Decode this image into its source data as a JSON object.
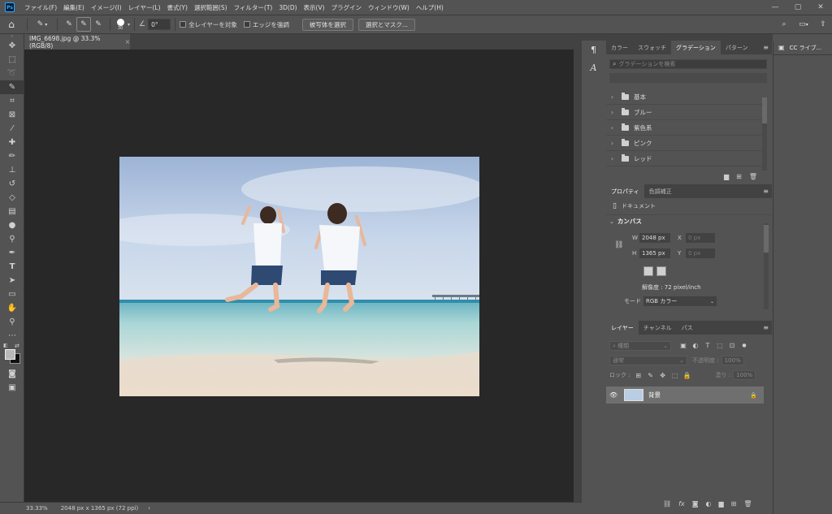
{
  "app": {
    "logo": "Ps"
  },
  "menu": [
    "ファイル(F)",
    "編集(E)",
    "イメージ(I)",
    "レイヤー(L)",
    "書式(Y)",
    "選択範囲(S)",
    "フィルター(T)",
    "3D(D)",
    "表示(V)",
    "プラグイン",
    "ウィンドウ(W)",
    "ヘルプ(H)"
  ],
  "window_controls": {
    "minimize": "—",
    "maximize": "▢",
    "close": "✕"
  },
  "options": {
    "brush_size": "30",
    "angle": "0°",
    "sample_all_layers": "全レイヤーを対象",
    "enhance_edge": "エッジを強調",
    "select_subject": "被写体を選択",
    "select_and_mask": "選択とマスク..."
  },
  "document": {
    "tab_title": "IMG_6698.jpg @ 33.3% (RGB/8)",
    "tab_close": "×"
  },
  "status": {
    "zoom": "33.33%",
    "info": "2048 px x 1365 px (72 ppi)",
    "arrow": "›"
  },
  "gradient_panel": {
    "tabs": [
      "カラー",
      "スウォッチ",
      "グラデーション",
      "パターン"
    ],
    "active_tab": 2,
    "search_placeholder": "グラデーションを検索",
    "folders": [
      "基本",
      "ブルー",
      "紫色系",
      "ピンク",
      "レッド"
    ]
  },
  "properties_panel": {
    "tabs": [
      "プロパティ",
      "色調補正"
    ],
    "active_tab": 0,
    "doc_label": "ドキュメント",
    "canvas_header": "カンバス",
    "w_label": "W",
    "w_value": "2048 px",
    "x_label": "X",
    "x_placeholder": "0 px",
    "h_label": "H",
    "h_value": "1365 px",
    "y_label": "Y",
    "y_placeholder": "0 px",
    "resolution": "解像度 : 72 pixel/inch",
    "mode_label": "モード",
    "mode_value": "RGB カラー"
  },
  "layers_panel": {
    "tabs": [
      "レイヤー",
      "チャンネル",
      "パス"
    ],
    "active_tab": 0,
    "filter_kind": "種類",
    "blend_mode": "通常",
    "opacity_label": "不透明度 :",
    "opacity_value": "100%",
    "lock_label": "ロック :",
    "fill_label": "塗り :",
    "fill_value": "100%",
    "layer_name": "背景"
  },
  "cc_panel": {
    "title": "CC ライブ..."
  },
  "colors": {
    "accent": "#31a8ff",
    "panel": "#535353",
    "dark": "#282828"
  }
}
